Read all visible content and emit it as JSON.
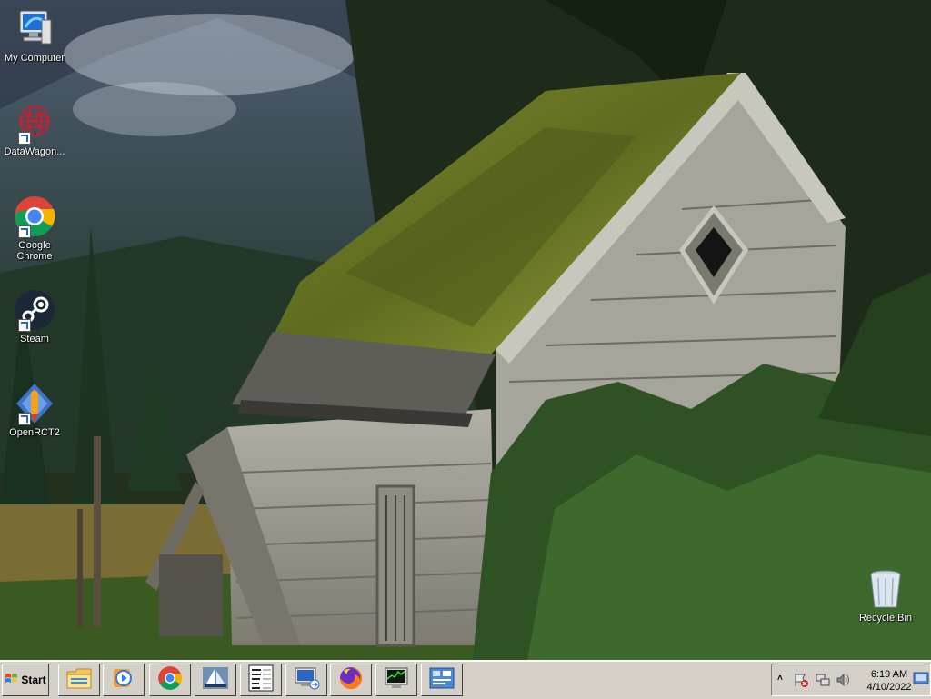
{
  "desktop": {
    "icons": [
      {
        "label": "My Computer",
        "icon": "computer-icon"
      },
      {
        "label": "DataWagon...",
        "icon": "datawagon-icon"
      },
      {
        "label": "Google Chrome",
        "icon": "chrome-icon"
      },
      {
        "label": "Steam",
        "icon": "steam-icon"
      },
      {
        "label": "OpenRCT2",
        "icon": "openrct2-icon"
      }
    ],
    "recycle_bin": {
      "label": "Recycle Bin",
      "icon": "recycle-bin-icon"
    }
  },
  "taskbar": {
    "start_label": "Start",
    "quick_launch": [
      "file-explorer-icon",
      "media-player-icon",
      "chrome-icon",
      "sailboat-app-icon",
      "address-form-icon",
      "remote-desktop-icon",
      "firefox-icon",
      "task-manager-icon",
      "control-panel-icon"
    ],
    "tray_icons": [
      "show-hidden-icons-chevron",
      "action-center-flag-icon",
      "network-icon",
      "volume-icon"
    ],
    "clock": {
      "time": "6:19 AM",
      "date": "4/10/2022"
    },
    "show_desktop_icon": "show-desktop-icon"
  },
  "colors": {
    "taskbar_bg": "#d4d0c8",
    "moss": "#6e7a22",
    "siding": "#9b9a90"
  }
}
